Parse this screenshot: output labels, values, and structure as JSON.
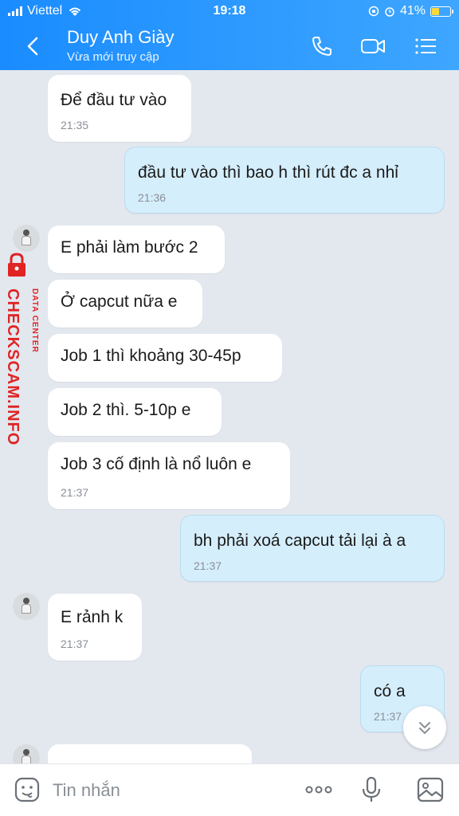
{
  "status_bar": {
    "carrier": "Viettel",
    "time": "19:18",
    "battery": "41%",
    "battery_level": 0.41
  },
  "header": {
    "title": "Duy Anh Giày",
    "subtitle": "Vừa mới truy cập"
  },
  "messages": [
    {
      "side": "in",
      "text": "Để đầu tư vào",
      "time": "21:35"
    },
    {
      "side": "out",
      "text": "đầu tư vào thì bao h thì rút đc a nhỉ",
      "time": "21:36"
    },
    {
      "side": "in",
      "text": "E phải làm bước 2",
      "time": ""
    },
    {
      "side": "in",
      "text": "Ở capcut nữa e",
      "time": ""
    },
    {
      "side": "in",
      "text": "Job 1 thì khoảng 30-45p",
      "time": ""
    },
    {
      "side": "in",
      "text": "Job 2 thì. 5-10p e",
      "time": ""
    },
    {
      "side": "in",
      "text": "Job 3 cố định là nổ luôn e",
      "time": "21:37"
    },
    {
      "side": "out",
      "text": "bh phải xoá capcut tải lại à a",
      "time": "21:37"
    },
    {
      "side": "in",
      "text": "E rảnh k",
      "time": "21:37"
    },
    {
      "side": "out",
      "text": "có a",
      "time": "21:37"
    }
  ],
  "watermark": {
    "text": "CHECKSCAM.INFO",
    "sub": "DATA CENTER"
  },
  "input": {
    "placeholder": "Tin nhắn"
  },
  "icons": {
    "back": "chevron-left-icon",
    "call": "phone-icon",
    "video": "video-camera-icon",
    "menu": "list-menu-icon",
    "sticker": "sticker-icon",
    "more": "more-dots-icon",
    "mic": "microphone-icon",
    "image": "image-icon",
    "scroll": "chevron-double-down-icon"
  },
  "colors": {
    "header_start": "#1a8cff",
    "header_end": "#3ea6ff",
    "bubble_out": "#d5eefc",
    "watermark": "#e02424"
  }
}
